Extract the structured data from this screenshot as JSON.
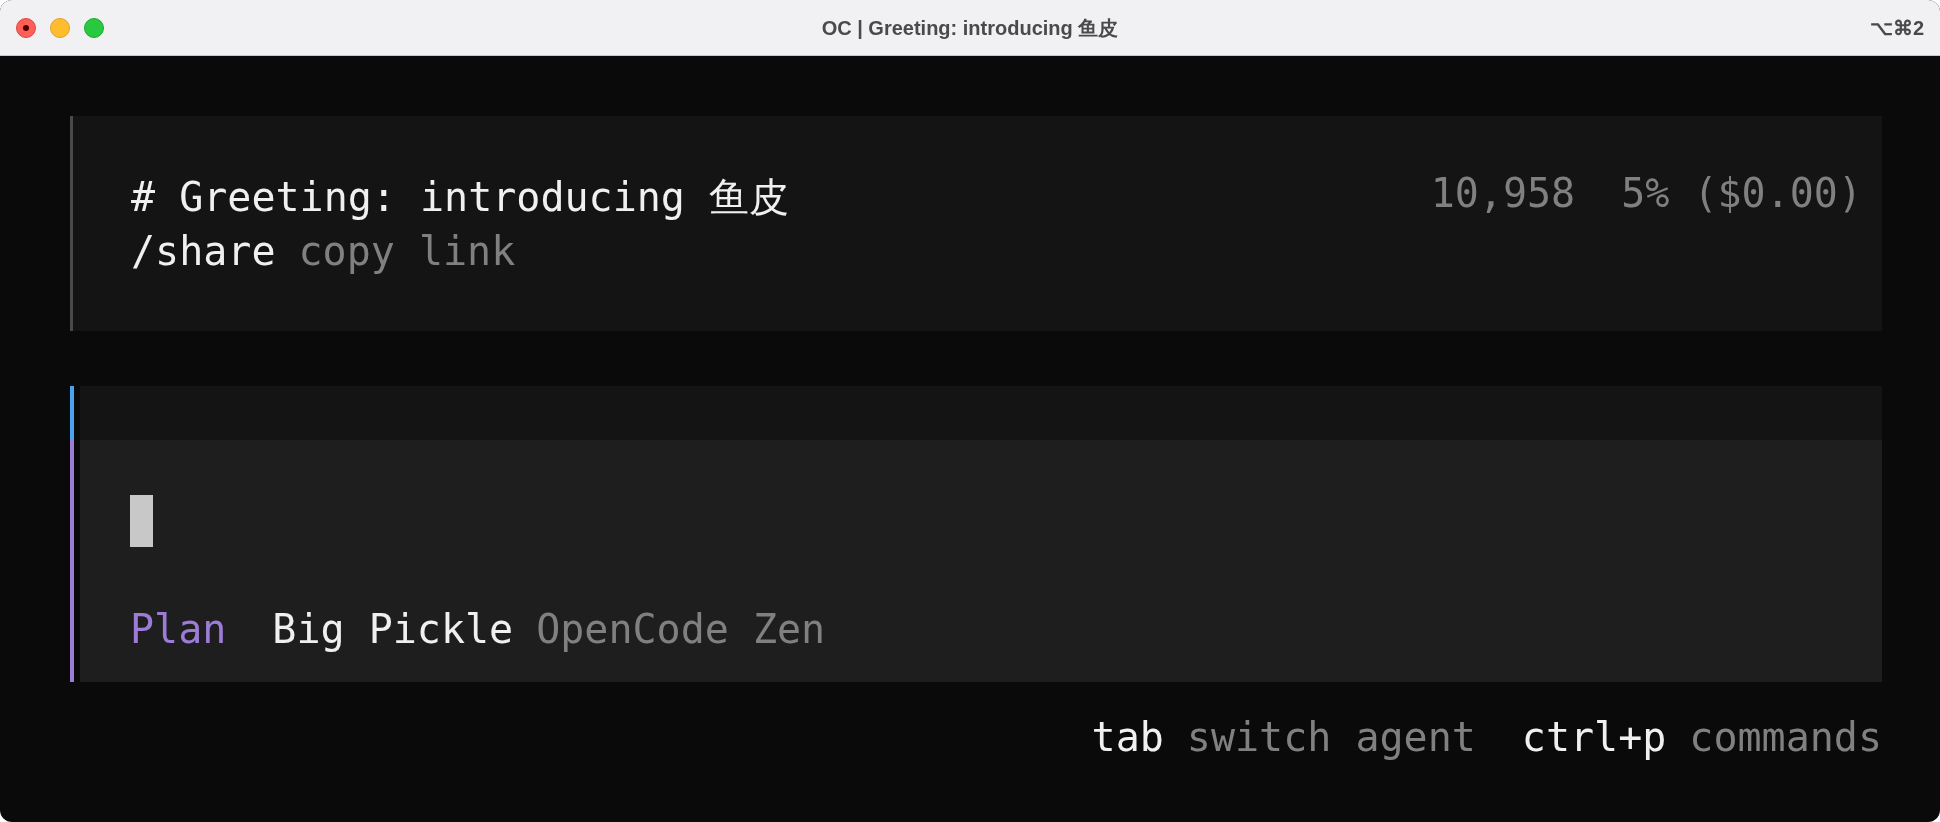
{
  "window": {
    "title": "OC | Greeting: introducing 鱼皮",
    "shortcut": "⌥⌘2"
  },
  "session": {
    "title": "# Greeting: introducing 鱼皮",
    "command": "/share",
    "command_hint": "copy link",
    "tokens": "10,958",
    "usage": "5% ($0.00)"
  },
  "prompt": {
    "agent": "Plan",
    "model": "Big Pickle",
    "provider": "OpenCode Zen",
    "focused": true
  },
  "hints": [
    {
      "key": "tab",
      "label": "switch agent"
    },
    {
      "key": "ctrl+p",
      "label": "commands"
    }
  ]
}
